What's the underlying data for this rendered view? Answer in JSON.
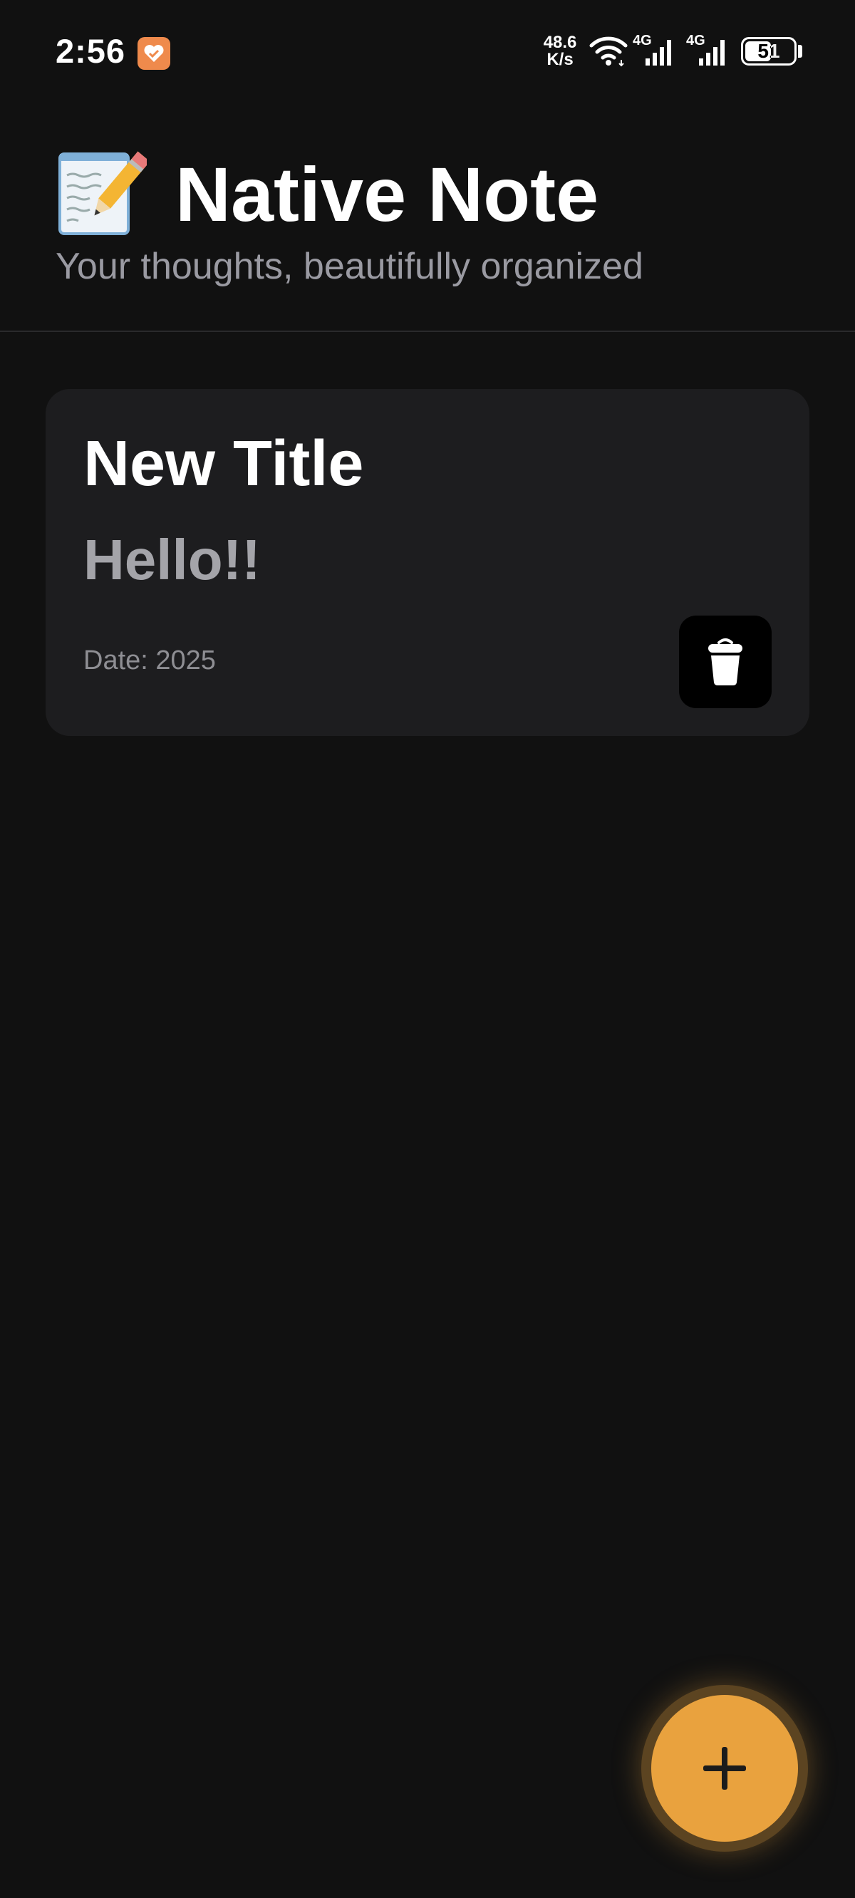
{
  "status_bar": {
    "time": "2:56",
    "net_speed_value": "48.6",
    "net_speed_unit": "K/s",
    "signal_1_label": "4G",
    "signal_2_label": "4G",
    "battery_level": "51",
    "icons": [
      "app-notification-icon",
      "wifi-icon",
      "signal-icon",
      "signal-icon",
      "battery-icon"
    ]
  },
  "header": {
    "icon": "memo-icon",
    "title": "Native Note",
    "subtitle": "Your thoughts, beautifully organized"
  },
  "notes": [
    {
      "title": "New Title",
      "body": "Hello!!",
      "date": "Date: 2025",
      "delete_icon": "trash-icon"
    }
  ],
  "fab": {
    "icon": "plus-icon"
  },
  "colors": {
    "background": "#111111",
    "card": "#1d1d1f",
    "accent": "#e9a23e",
    "subtitle": "#9a9aa2",
    "body_text": "#a4a4a9"
  }
}
